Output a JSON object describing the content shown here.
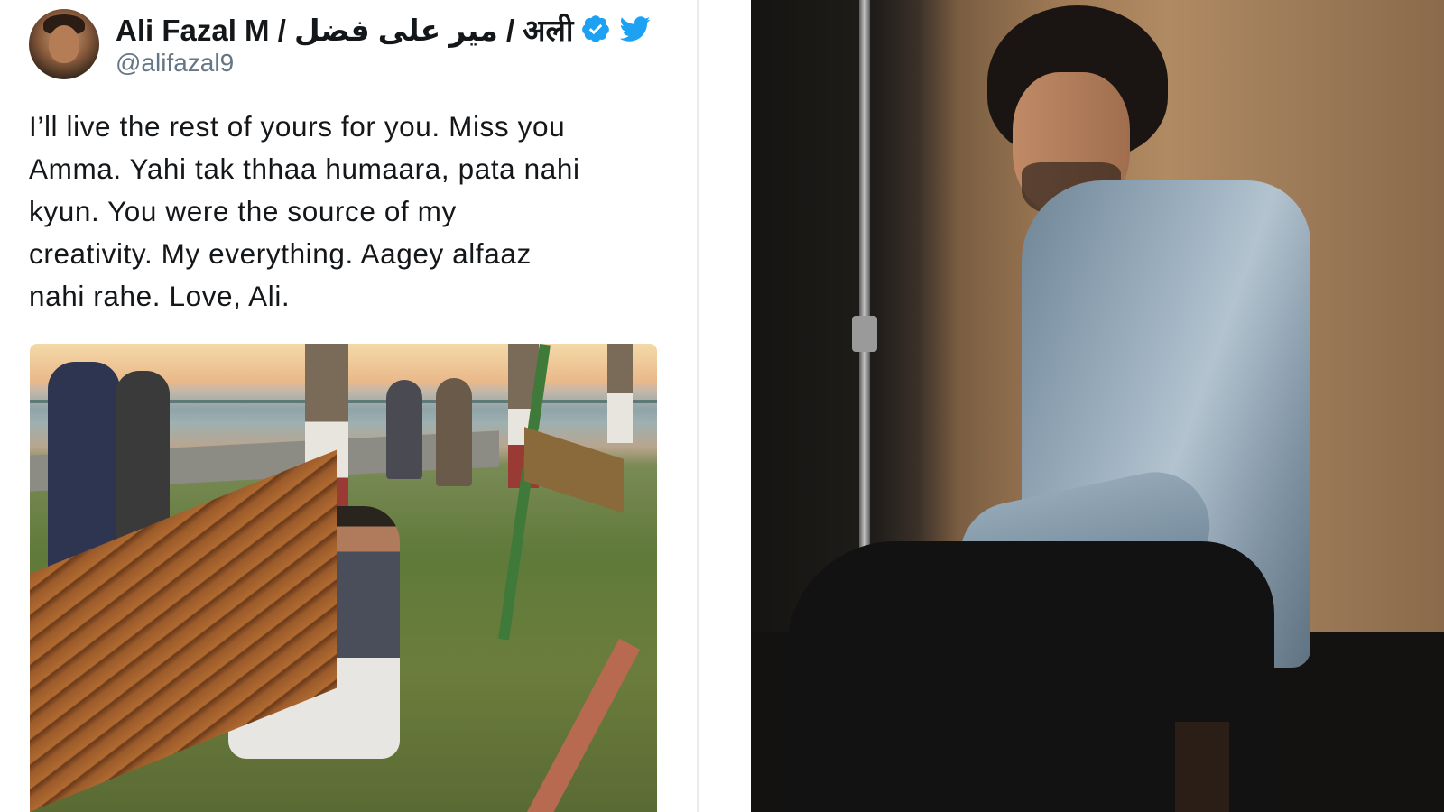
{
  "tweet": {
    "avatar_icon": "user-avatar",
    "display_name": "Ali Fazal M / میر علی فضل / अली",
    "verified_icon": "verified-badge-icon",
    "twitter_icon": "twitter-bird-icon",
    "handle": "@alifazal9",
    "text_lines": [
      "I’ll live the rest of yours for you. Miss you",
      "Amma. Yahi tak thhaa humaara, pata nahi",
      "kyun. You were the source of my",
      "creativity. My everything. Aagey alfaaz",
      "nahi rahe. Love, Ali."
    ]
  },
  "colors": {
    "twitter_blue": "#1da1f2",
    "text_primary": "#14171a",
    "text_secondary": "#657786"
  }
}
